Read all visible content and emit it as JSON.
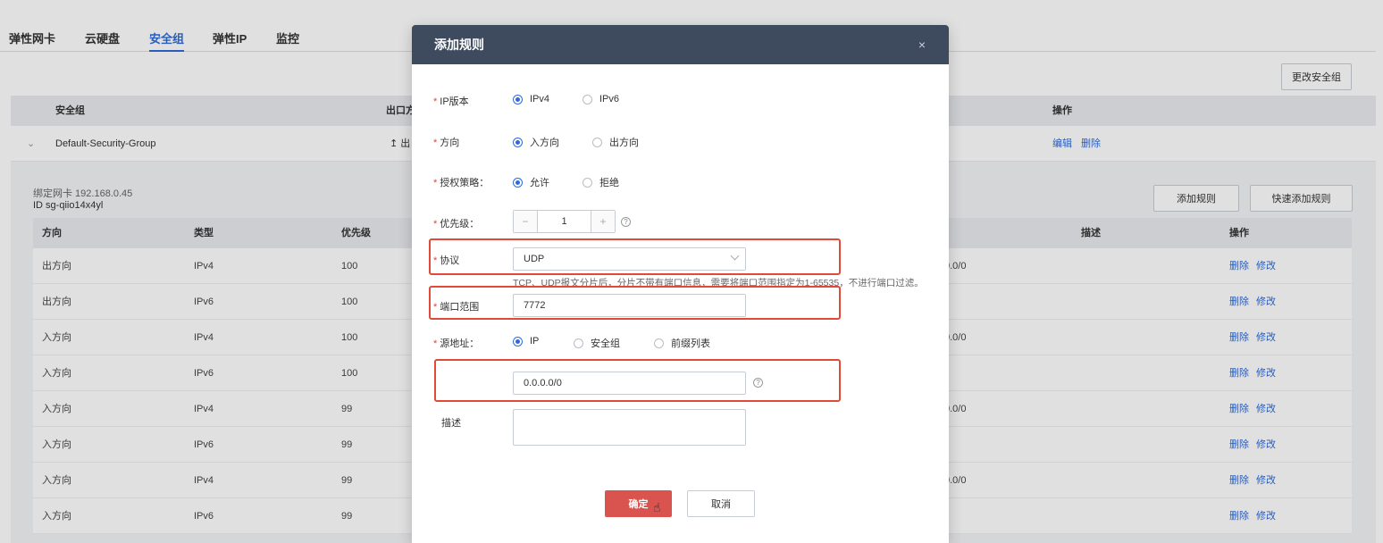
{
  "tabs": [
    "弹性网卡",
    "云硬盘",
    "安全组",
    "弹性IP",
    "监控"
  ],
  "change_sg_button": "更改安全组",
  "sg_table": {
    "headers": {
      "sg": "安全组",
      "outbound": "出口方",
      "actions": "操作"
    },
    "row": {
      "name": "Default-Security-Group",
      "outbound": "↥ 出",
      "edit": "编辑",
      "delete": "删除"
    }
  },
  "detail": {
    "nic": "绑定网卡 192.168.0.45",
    "sg_id": "ID sg-qiio14x4yl",
    "add_rule": "添加规则",
    "quick_add": "快速添加规则"
  },
  "rule_table": {
    "headers": {
      "direction": "方向",
      "type": "类型",
      "priority": "优先级",
      "desc": "描述",
      "actions": "操作"
    },
    "rows": [
      {
        "direction": "出方向",
        "type": "IPv4",
        "priority": "100",
        "addr": "0.0/0"
      },
      {
        "direction": "出方向",
        "type": "IPv6",
        "priority": "100",
        "addr": ""
      },
      {
        "direction": "入方向",
        "type": "IPv4",
        "priority": "100",
        "addr": "0.0/0"
      },
      {
        "direction": "入方向",
        "type": "IPv6",
        "priority": "100",
        "addr": ""
      },
      {
        "direction": "入方向",
        "type": "IPv4",
        "priority": "99",
        "addr": "0.0/0"
      },
      {
        "direction": "入方向",
        "type": "IPv6",
        "priority": "99",
        "addr": ""
      },
      {
        "direction": "入方向",
        "type": "IPv4",
        "priority": "99",
        "addr": "0.0/0"
      },
      {
        "direction": "入方向",
        "type": "IPv6",
        "priority": "99",
        "addr": ""
      }
    ],
    "row_delete": "删除",
    "row_edit": "修改"
  },
  "modal": {
    "title": "添加规则",
    "close": "×",
    "ip_version": {
      "label": "IP版本",
      "opt1": "IPv4",
      "opt2": "IPv6"
    },
    "direction": {
      "label": "方向",
      "opt1": "入方向",
      "opt2": "出方向"
    },
    "policy": {
      "label": "授权策略：",
      "opt1": "允许",
      "opt2": "拒绝"
    },
    "priority": {
      "label": "优先级：",
      "minus": "−",
      "value": "1",
      "plus": "+"
    },
    "protocol": {
      "label": "协议",
      "value": "UDP"
    },
    "hint": "TCP、UDP报文分片后，分片不带有端口信息，需要将端口范围指定为1-65535，不进行端口过滤。",
    "port": {
      "label": "端口范围",
      "value": "7772"
    },
    "source": {
      "label": "源地址：",
      "opt1": "IP",
      "opt2": "安全组",
      "opt3": "前缀列表"
    },
    "source_value": "0.0.0.0/0",
    "desc_label": "描述",
    "ok": "确定",
    "cancel": "取消"
  }
}
